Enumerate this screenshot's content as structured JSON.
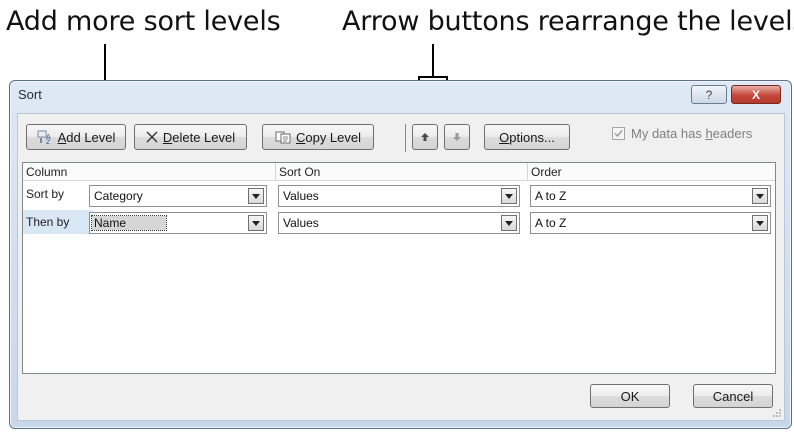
{
  "callouts": {
    "left": "Add more sort levels",
    "right": "Arrow buttons rearrange the levels"
  },
  "dialog": {
    "title": "Sort",
    "help_label": "?",
    "close_label": "X"
  },
  "toolbar": {
    "add_level": {
      "pre": "",
      "ul": "A",
      "post": "dd Level"
    },
    "delete_level": {
      "pre": "",
      "ul": "D",
      "post": "elete Level"
    },
    "copy_level": {
      "pre": "",
      "ul": "C",
      "post": "opy Level"
    },
    "options": {
      "pre": "",
      "ul": "O",
      "post": "ptions..."
    },
    "headers_checkbox": {
      "pre": "My data has ",
      "ul": "h",
      "post": "eaders",
      "checked": true,
      "enabled": false
    }
  },
  "grid": {
    "columns": [
      "Column",
      "Sort On",
      "Order"
    ],
    "rows": [
      {
        "label": "Sort by",
        "column": "Category",
        "sort_on": "Values",
        "order": "A to Z"
      },
      {
        "label": "Then by",
        "column": "Name",
        "sort_on": "Values",
        "order": "A to Z"
      }
    ]
  },
  "footer": {
    "ok": "OK",
    "cancel": "Cancel"
  },
  "icons": {
    "add": "add-level-icon",
    "delete": "delete-x-icon",
    "copy": "copy-icon",
    "up": "move-up-arrow-icon",
    "down": "move-down-arrow-icon",
    "dropdown": "dropdown-arrow-icon"
  }
}
